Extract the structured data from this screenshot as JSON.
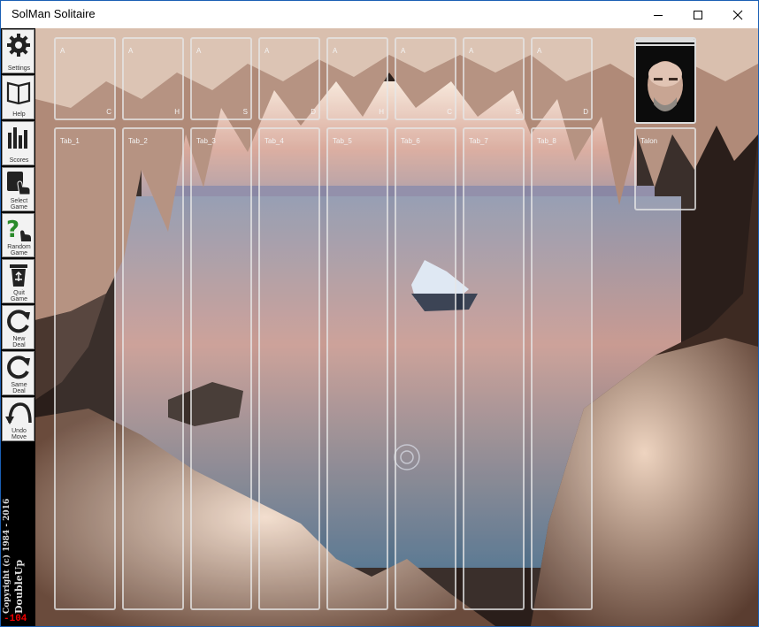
{
  "window": {
    "title": "SolMan Solitaire",
    "controls": {
      "minimize": "minimize",
      "maximize": "maximize",
      "close": "close"
    }
  },
  "sidebar": {
    "tools": [
      {
        "label1": "Settings",
        "label2": "",
        "icon": "gear-icon"
      },
      {
        "label1": "Help",
        "label2": "",
        "icon": "book-icon"
      },
      {
        "label1": "Scores",
        "label2": "",
        "icon": "bar-chart-icon"
      },
      {
        "label1": "Select",
        "label2": "Game",
        "icon": "hand-pointer-icon"
      },
      {
        "label1": "Random",
        "label2": "Game",
        "icon": "question-hand-icon"
      },
      {
        "label1": "Quit",
        "label2": "Game",
        "icon": "recycle-bin-icon"
      },
      {
        "label1": "New",
        "label2": "Deal",
        "icon": "refresh-icon"
      },
      {
        "label1": "Same",
        "label2": "Deal",
        "icon": "refresh-icon"
      },
      {
        "label1": "Undo",
        "label2": "Move",
        "icon": "undo-arrow-icon"
      }
    ],
    "copyright": "Copyright (c) 1984 - 2016",
    "brand": "DoubleUp",
    "counter": "-104"
  },
  "foundations": [
    {
      "label": "A",
      "suit": "C"
    },
    {
      "label": "A",
      "suit": "H"
    },
    {
      "label": "A",
      "suit": "S"
    },
    {
      "label": "A",
      "suit": "D"
    },
    {
      "label": "A",
      "suit": "H"
    },
    {
      "label": "A",
      "suit": "C"
    },
    {
      "label": "A",
      "suit": "S"
    },
    {
      "label": "A",
      "suit": "D"
    }
  ],
  "tableaus": [
    "Tab_1",
    "Tab_2",
    "Tab_3",
    "Tab_4",
    "Tab_5",
    "Tab_6",
    "Tab_7",
    "Tab_8"
  ],
  "stock": {
    "icon": "player-avatar"
  },
  "talon": {
    "label": "Talon"
  },
  "colors": {
    "accent": "#1a5fb4",
    "counter": "#e00000",
    "pile_border": "#e6e6e6"
  }
}
